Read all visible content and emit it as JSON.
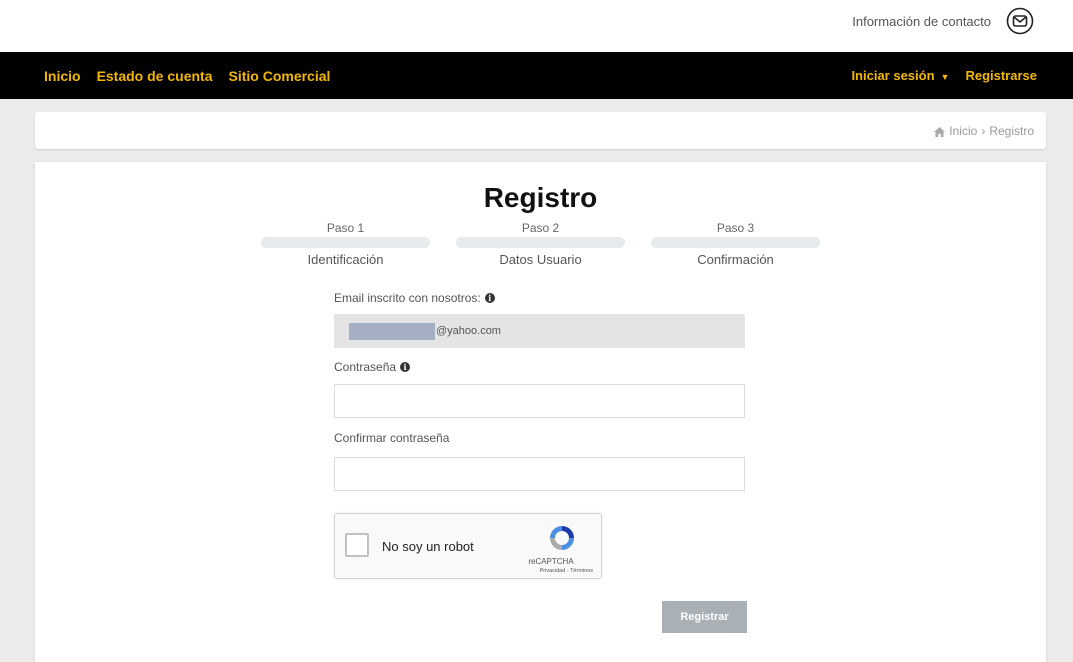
{
  "header": {
    "contact_label": "Información de contacto",
    "contact_icon": "mail-icon"
  },
  "nav": {
    "left": [
      "Inicio",
      "Estado de cuenta",
      "Sitio Comercial"
    ],
    "login": "Iniciar sesión",
    "register": "Registrarse",
    "accent_color": "#f2b705"
  },
  "breadcrumb": {
    "home_icon": "home-icon",
    "items": [
      "Inicio",
      "Registro"
    ],
    "separator": "›"
  },
  "page": {
    "title": "Registro",
    "steps": [
      {
        "num": "Paso 1",
        "name": "Identificación"
      },
      {
        "num": "Paso 2",
        "name": "Datos Usuario"
      },
      {
        "num": "Paso 3",
        "name": "Confirmación"
      }
    ]
  },
  "form": {
    "email_label": "Email inscrito con nosotros:",
    "email_suffix": "@yahoo.com",
    "password_label": "Contraseña",
    "password_value": "",
    "confirm_label": "Confirmar contraseña",
    "confirm_value": "",
    "info_icon": "info-icon"
  },
  "recaptcha": {
    "label": "No soy un robot",
    "brand": "reCAPTCHA",
    "links": "Privacidad - Términos"
  },
  "submit_label": "Registrar"
}
